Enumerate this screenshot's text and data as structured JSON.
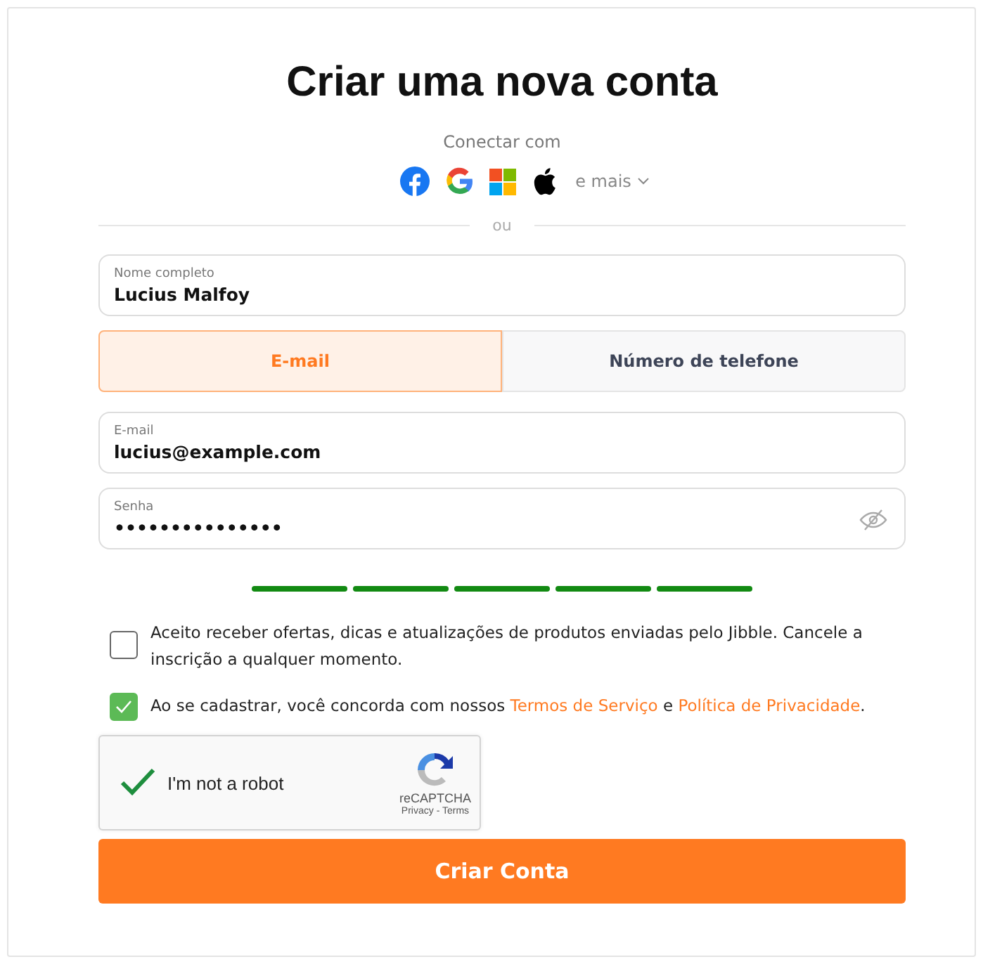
{
  "title": "Criar uma nova conta",
  "connect": {
    "label": "Conectar com",
    "providers": [
      {
        "kind": "facebook"
      },
      {
        "kind": "google"
      },
      {
        "kind": "microsoft"
      },
      {
        "kind": "apple"
      }
    ],
    "more": "e mais"
  },
  "divider": "ou",
  "name_field": {
    "label": "Nome completo",
    "value": "Lucius Malfoy"
  },
  "tabs": [
    {
      "label": "E-mail",
      "selected": true
    },
    {
      "label": "Número de telefone",
      "selected": false
    }
  ],
  "email_field": {
    "label": "E-mail",
    "value": "lucius@example.com"
  },
  "password_field": {
    "label": "Senha",
    "value": "•••••••••••••••"
  },
  "password_strength": [
    {
      "filled": true
    },
    {
      "filled": true
    },
    {
      "filled": true
    },
    {
      "filled": true
    },
    {
      "filled": true
    }
  ],
  "checkboxes": [
    {
      "checked": false,
      "parts": [
        {
          "text": "Aceito receber ofertas, dicas e atualizações de produtos enviadas pelo Jibble. Cancele a inscrição a qualquer momento."
        }
      ]
    },
    {
      "checked": true,
      "parts": [
        {
          "text": "Ao se cadastrar, você concorda com nossos "
        },
        {
          "text": "Termos de Serviço",
          "link": true
        },
        {
          "text": " e "
        },
        {
          "text": "Política de Privacidade",
          "link": true
        },
        {
          "text": "."
        }
      ]
    }
  ],
  "captcha": {
    "checked": true,
    "label": "I'm not a robot",
    "brand": "reCAPTCHA",
    "privacy": "Privacy",
    "separator": "-",
    "terms": "Terms"
  },
  "submit": "Criar Conta"
}
